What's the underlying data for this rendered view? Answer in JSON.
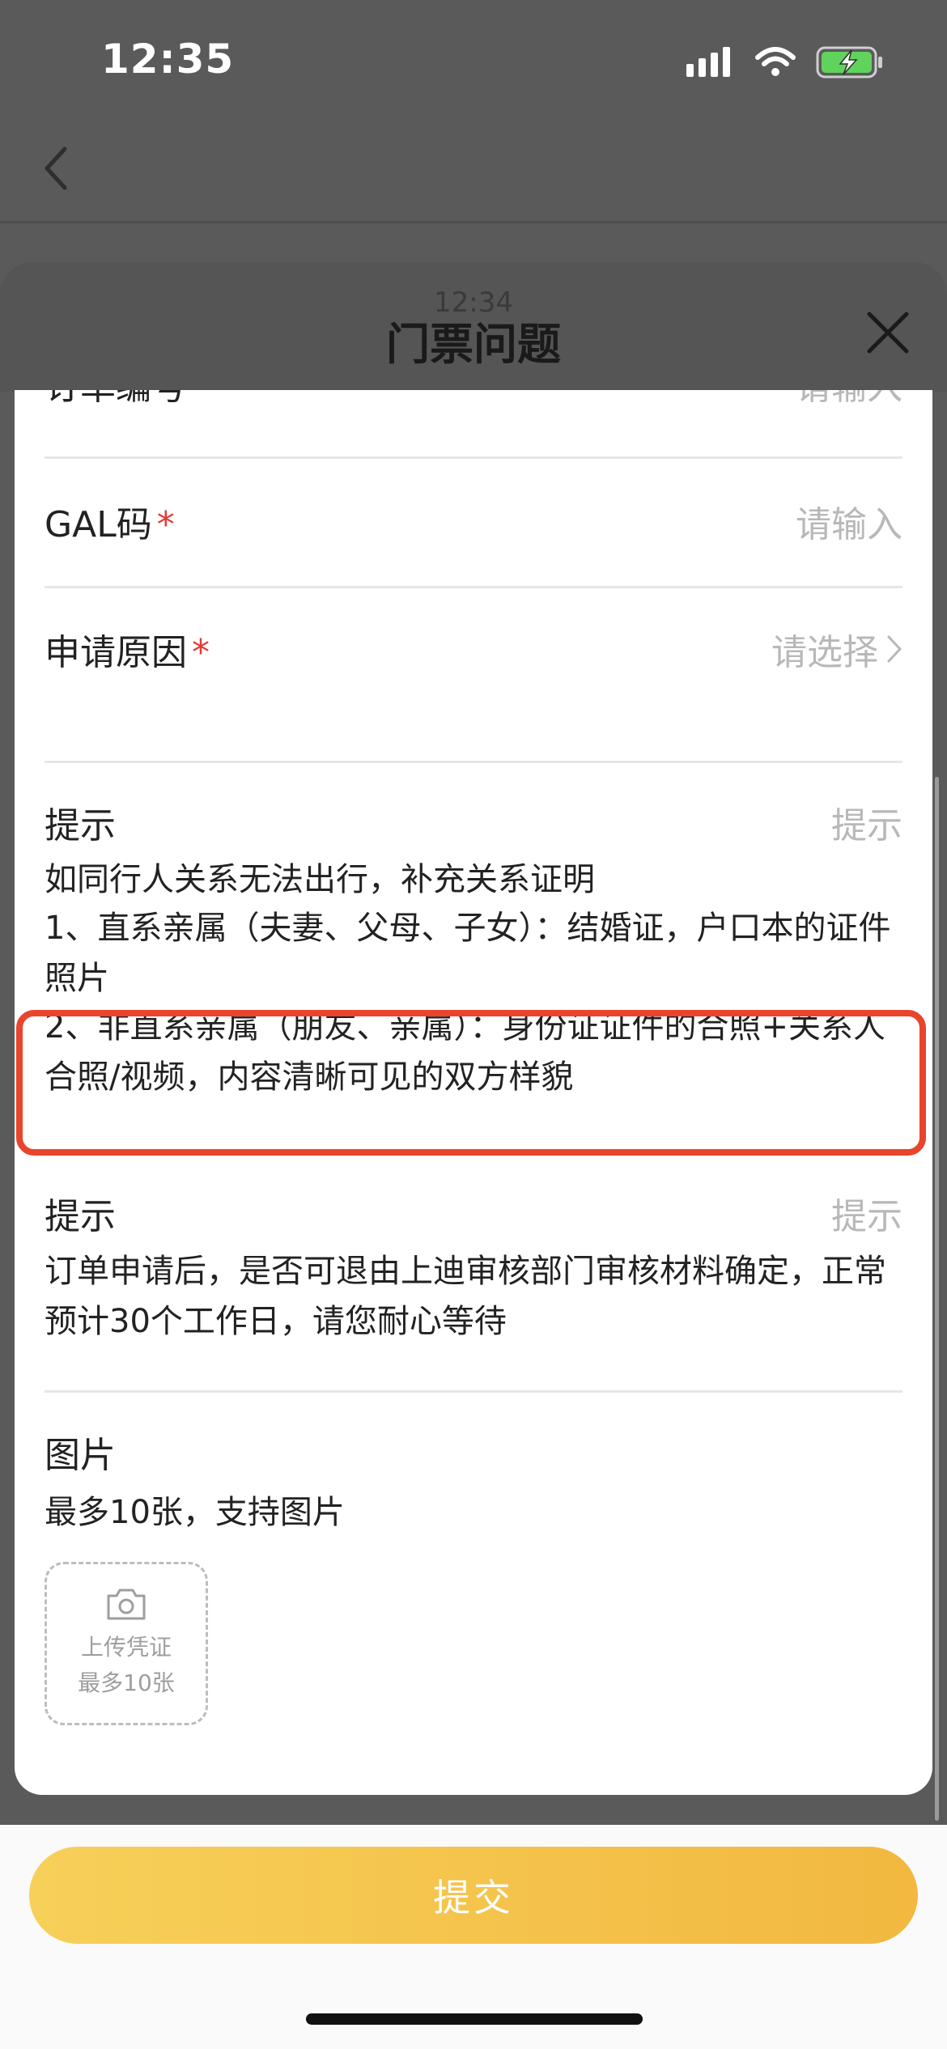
{
  "status_bar": {
    "time": "12:35",
    "icons": [
      "signal-icon",
      "wifi-icon",
      "battery-charging-icon"
    ]
  },
  "nav": {
    "back_icon": "chevron-left-icon"
  },
  "sheet": {
    "ghost_time": "12:34",
    "title": "门票问题",
    "close_icon": "close-icon"
  },
  "form": {
    "order_row": {
      "label": "订单编号",
      "placeholder": "请输入"
    },
    "gal_row": {
      "label": "GAL码",
      "required_mark": "*",
      "placeholder": "请输入"
    },
    "reason_row": {
      "label": "申请原因",
      "required_mark": "*",
      "placeholder": "请选择",
      "chevron_icon": "chevron-right-icon"
    },
    "tip1": {
      "label": "提示",
      "right_label": "提示",
      "line1": "如同行人关系无法出行，补充关系证明",
      "line2": "1、直系亲属（夫妻、父母、子女）：结婚证，户口本的证件照片",
      "line3": "2、非直系亲属（朋友、亲属）：身份证证件的合照+关系人合照/视频，内容清晰可见的双方样貌"
    },
    "tip2": {
      "label": "提示",
      "right_label": "提示",
      "text": "订单申请后，是否可退由上迪审核部门审核材料确定，正常预计30个工作日，请您耐心等待"
    },
    "images": {
      "label": "图片",
      "sub": "最多10张，支持图片",
      "upload_line1": "上传凭证",
      "upload_line2": "最多10张",
      "camera_icon": "camera-icon"
    }
  },
  "colors": {
    "highlight": "#e8452c",
    "required": "#e53935",
    "submit_gradient_start": "#f7d059",
    "submit_gradient_end": "#f2b840"
  },
  "submit": {
    "label": "提交"
  }
}
